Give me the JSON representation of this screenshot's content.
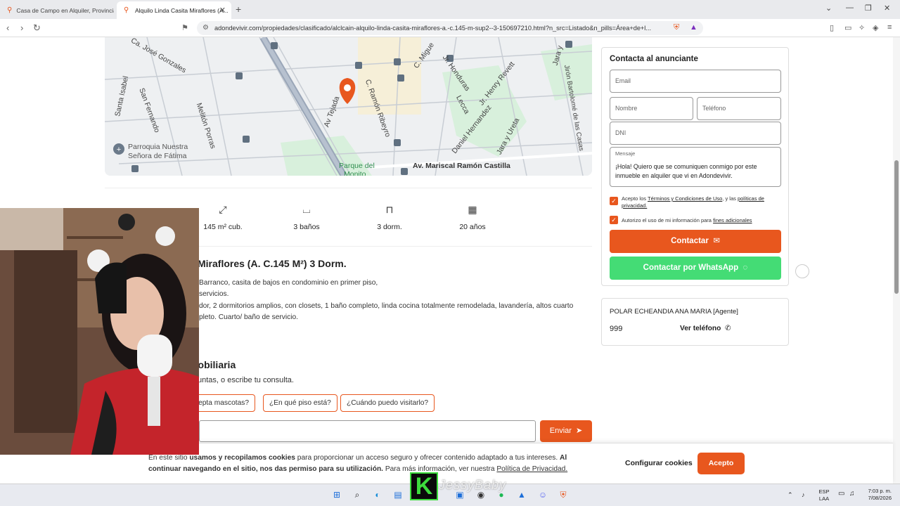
{
  "browser": {
    "tabs": [
      {
        "title": "Casa de Campo en Alquiler, Provincia..."
      },
      {
        "title": "Alquilo Linda Casita Miraflores (A..."
      }
    ],
    "url": "adondevivir.com/propiedades/clasificado/alclcain-alquilo-linda-casita-miraflores-a.-c.145-m-sup2--3-150697210.html?n_src=Listado&n_pills=Área+de+l..."
  },
  "map": {
    "labels": {
      "jose_gonzales": "Ca. José Gonzales",
      "santa_isabel": "Santa Isabel",
      "san_fernando": "San Fernando",
      "meliton_porras": "Melitón Porras",
      "av_tejada": "Av Tejada",
      "ramon_ribeyro": "C. Ramón Ribeyro",
      "c_miguel": "C. Migue",
      "jr_honduras": "Jr. Honduras",
      "jr_henry_revett": "Jr. Henry Revett",
      "lecca": "Lecca",
      "daniel_hernandez": "Daniel Hernandez",
      "jara_y_ureta": "Jara y Ureta",
      "jara_y": "Jara y",
      "bartolome": "Jirón Bartolomé de las Casas",
      "parroquia_1": "Parroquia Nuestra",
      "parroquia_2": "Señora de Fátima",
      "parque": "Parque del",
      "parque_2": "Monito",
      "castilla": "Av. Mariscal Ramón Castilla"
    }
  },
  "features": [
    {
      "label": "145 m² cub.",
      "icon": "area-icon"
    },
    {
      "label": "3 baños",
      "icon": "bath-icon"
    },
    {
      "label": "3 dorm.",
      "icon": "bed-icon"
    },
    {
      "label": "20 años",
      "icon": "calendar-icon"
    }
  ],
  "listing": {
    "title": "Miraflores (A. C.145 M²) 3 Dorm.",
    "desc_lines": [
      "Barranco, casita de bajos en condominio en primer piso,",
      "servicios.",
      "dor, 2 dormitorios amplios, con closets, 1 baño completo, linda cocina totalmente remodelada, lavandería, altos cuarto",
      "pleto. Cuarto/ baño de servicio."
    ]
  },
  "inmobiliaria": {
    "title": "nobiliaria",
    "subtitle": "untas, o escribe tu consulta.",
    "pills": [
      "cepta mascotas?",
      "¿En qué piso está?",
      "¿Cuándo puedo visitarlo?"
    ],
    "send": "Enviar"
  },
  "contact": {
    "title": "Contacta al anunciante",
    "email_ph": "Email",
    "nombre_ph": "Nombre",
    "telefono_ph": "Teléfono",
    "dni_ph": "DNI",
    "mensaje_label": "Mensaje",
    "mensaje": "¡Hola! Quiero que se comuniquen conmigo por este inmueble en alquiler que vi en Adondevivir.",
    "check1_pre": "Acepto los ",
    "check1_link1": "Términos y Condiciones de Uso",
    "check1_mid": ", y las ",
    "check1_link2": "políticas de privacidad.",
    "check2_pre": "Autorizo el uso de mi información para ",
    "check2_link": "fines adicionales",
    "btn_contact": "Contactar",
    "btn_whatsapp": "Contactar por WhatsApp"
  },
  "agent": {
    "name": "POLAR ECHEANDIA ANA MARIA [Agente]",
    "number": "999",
    "phone_btn": "Ver teléfono"
  },
  "cookies": {
    "t1": "En este sitio ",
    "t2": "usamos y recopilamos cookies",
    "t3": " para proporcionar un acceso seguro y ofrecer contenido adaptado a tus intereses. ",
    "t4": "Al continuar navegando en el sitio, nos das permiso para su utilización.",
    "t5": " Para más información, ver nuestra ",
    "t6": "Política de Privacidad.",
    "config": "Configurar cookies",
    "accept": "Acepto"
  },
  "overlay": {
    "k": "K",
    "watermark": "JessyBaby"
  },
  "taskbar": {
    "lang1": "ESP",
    "lang2": "LAA",
    "time": "7:03 p. m.",
    "date": "7/08/2026"
  }
}
